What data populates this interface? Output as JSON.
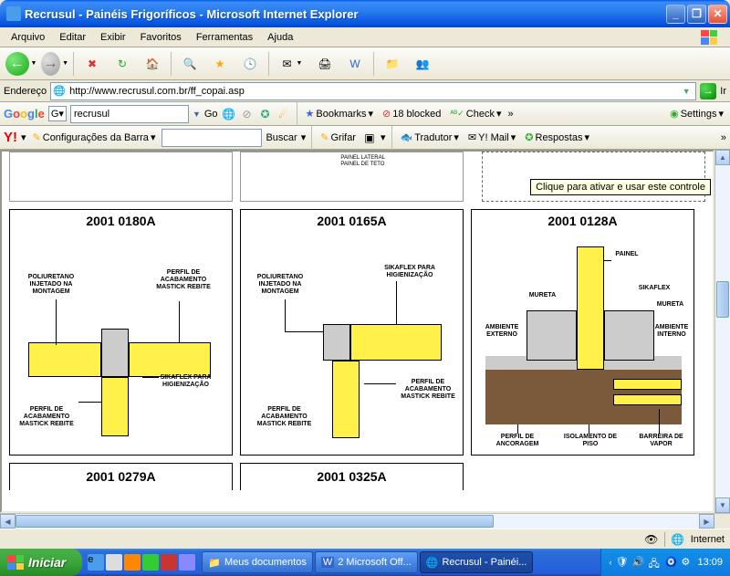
{
  "window": {
    "title": "Recrusul - Painéis Frigoríficos - Microsoft Internet Explorer"
  },
  "menu": {
    "file": "Arquivo",
    "edit": "Editar",
    "view": "Exibir",
    "favorites": "Favoritos",
    "tools": "Ferramentas",
    "help": "Ajuda"
  },
  "address": {
    "label": "Endereço",
    "url": "http://www.recrusul.com.br/ff_copai.asp",
    "go": "Ir"
  },
  "google_bar": {
    "logo": "Google",
    "prefix": "G",
    "search_value": "recrusul",
    "go": "Go",
    "bookmarks": "Bookmarks",
    "blocked_count": "18 blocked",
    "check": "Check",
    "settings": "Settings"
  },
  "yahoo_bar": {
    "logo": "Y!",
    "config": "Configurações da Barra",
    "search_value": "",
    "buscar": "Buscar",
    "grifar": "Grifar",
    "tradutor": "Tradutor",
    "mail": "Y! Mail",
    "respostas": "Respostas"
  },
  "content": {
    "tooltip": "Clique para ativar e usar este controle",
    "top_label1": "PAINEL LATERAL",
    "top_label2": "PAINEL DE TETO",
    "panels": [
      {
        "code": "2001 0180A",
        "labels": {
          "l1": "POLIURETANO INJETADO NA MONTAGEM",
          "l2": "PERFIL DE ACABAMENTO MASTICK REBITE",
          "l3": "SIKAFLEX PARA HIGIENIZAÇÃO",
          "l4": "PERFIL DE ACABAMENTO MASTICK REBITE"
        }
      },
      {
        "code": "2001 0165A",
        "labels": {
          "l1": "POLIURETANO INJETADO NA MONTAGEM",
          "l2": "SIKAFLEX PARA HIGIENIZAÇÃO",
          "l3": "PERFIL DE ACABAMENTO MASTICK REBITE",
          "l4": "PERFIL DE ACABAMENTO MASTICK REBITE"
        }
      },
      {
        "code": "2001 0128A",
        "labels": {
          "l1": "PAINEL",
          "l2": "MURETA",
          "l3": "SIKAFLEX",
          "l4": "MURETA",
          "l5": "AMBIENTE EXTERNO",
          "l6": "AMBIENTE INTERNO",
          "l7": "PERFIL DE ANCORAGEM",
          "l8": "ISOLAMENTO DE PISO",
          "l9": "BARREIRA DE VAPOR"
        }
      }
    ],
    "bottom_panels": [
      "2001 0279A",
      "2001 0325A"
    ]
  },
  "statusbar": {
    "zone": "Internet"
  },
  "taskbar": {
    "start": "Iniciar",
    "tasks": [
      {
        "label": "Meus documentos"
      },
      {
        "label": "2 Microsoft Off..."
      },
      {
        "label": "Recrusul - Painéi..."
      }
    ],
    "clock": "13:09"
  }
}
